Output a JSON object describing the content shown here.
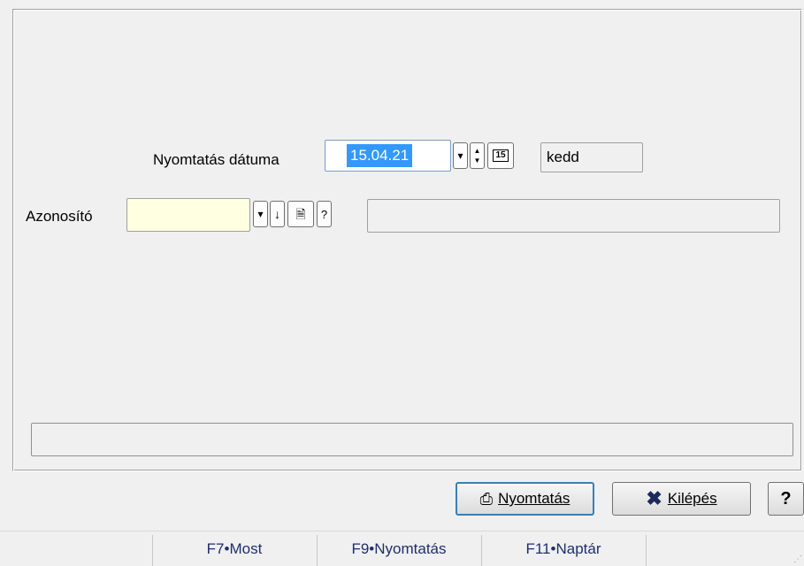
{
  "form": {
    "print_date_label": "Nyomtatás dátuma",
    "print_date_value": "15.04.21",
    "day_name": "kedd",
    "id_label": "Azonosító",
    "id_value": "",
    "id_description": "",
    "progress_text": ""
  },
  "buttons": {
    "print": "Nyomtatás",
    "exit": "Kilépés",
    "help": "?"
  },
  "icons": {
    "dropdown": "▾",
    "spin_up": "▲",
    "spin_down": "▼",
    "calendar_day": "15",
    "arrow_down": "↓",
    "doc": "🗎",
    "question": "?"
  },
  "statusbar": {
    "items": [
      "F7•Most",
      "F9•Nyomtatás",
      "F11•Naptár"
    ]
  },
  "colors": {
    "selection": "#3399ff",
    "yellow_field": "#ffffe1",
    "exit_icon": "#1a2a5a"
  }
}
